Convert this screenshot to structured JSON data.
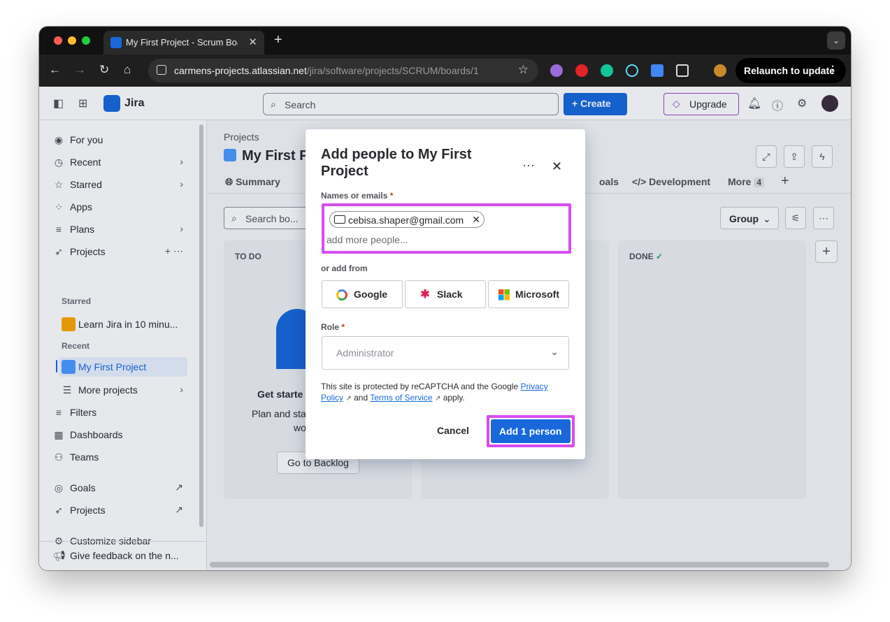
{
  "browser": {
    "tab_title": "My First Project - Scrum Boar",
    "url_main": "carmens-projects.atlassian.net",
    "url_path": "/jira/software/projects/SCRUM/boards/1",
    "relaunch_label": "Relaunch to update"
  },
  "header": {
    "app_name": "Jira",
    "search_placeholder": "Search",
    "create_label": "Create",
    "upgrade_label": "Upgrade"
  },
  "sidebar": {
    "items": [
      {
        "label": "For you"
      },
      {
        "label": "Recent"
      },
      {
        "label": "Starred"
      },
      {
        "label": "Apps"
      },
      {
        "label": "Plans"
      },
      {
        "label": "Projects"
      }
    ],
    "starred_section": "Starred",
    "starred_project": "Learn Jira in 10 minu...",
    "recent_section": "Recent",
    "recent_project": "My First Project",
    "more_projects": "More projects",
    "filters": "Filters",
    "dashboards": "Dashboards",
    "teams": "Teams",
    "goals": "Goals",
    "projects_app": "Projects",
    "customize": "Customize sidebar",
    "feedback": "Give feedback on the n..."
  },
  "main": {
    "breadcrumb": "Projects",
    "project_title": "My First P",
    "tabs": {
      "summary": "Summary",
      "goals": "oals",
      "development": "Development",
      "more": "More",
      "more_count": "4"
    },
    "search_board_placeholder": "Search bo...",
    "group_label": "Group",
    "columns": {
      "todo": "TO DO",
      "done": "DONE"
    },
    "get_started": "Get starte",
    "plan_text": "Plan and sta",
    "plan_text2": "wo",
    "backlog_button": "Go to Backlog"
  },
  "modal": {
    "title": "Add people to My First Project",
    "names_label": "Names or emails",
    "required_mark": "*",
    "chip_email": "cebisa.shaper@gmail.com",
    "add_more_placeholder": "add more people...",
    "or_add_from": "or add from",
    "sso": {
      "google": "Google",
      "slack": "Slack",
      "microsoft": "Microsoft"
    },
    "role_label": "Role",
    "role_value": "Administrator",
    "legal_prefix": "This site is protected by reCAPTCHA and the Google ",
    "privacy_link": "Privacy Policy",
    "legal_and": "and",
    "terms_link": "Terms of Service",
    "legal_suffix": "apply.",
    "cancel_label": "Cancel",
    "add_label": "Add 1 person"
  }
}
